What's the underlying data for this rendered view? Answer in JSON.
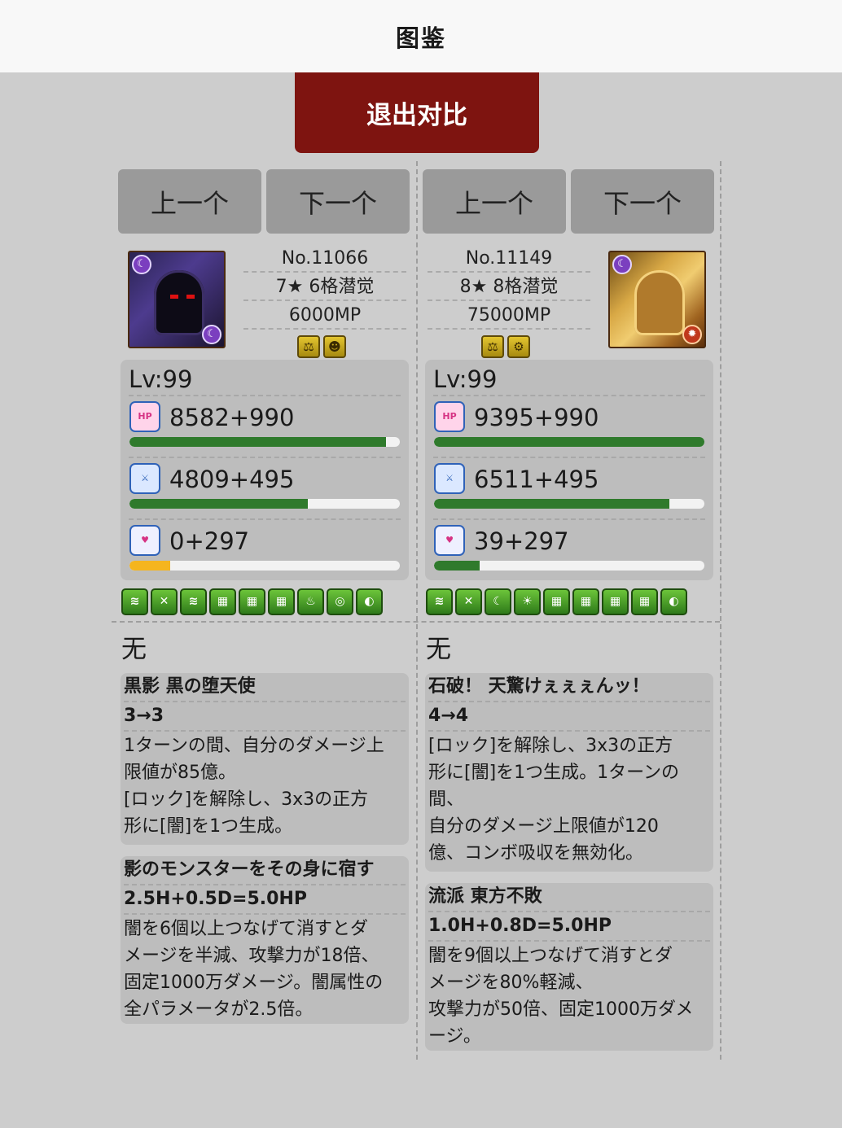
{
  "header": {
    "title": "图鉴"
  },
  "exit_button": "退出对比",
  "left": {
    "prev": "上一个",
    "next": "下一个",
    "number": "No.11066",
    "rarity": "7★ 6格潜觉",
    "mp": "6000MP",
    "types": [
      "balance-type-icon",
      "demon-type-icon"
    ],
    "level": "Lv:99",
    "hp": "8582+990",
    "atk": "4809+495",
    "rcv": "0+297",
    "hp_ratio": 0.95,
    "atk_ratio": 0.66,
    "rcv_ratio": 0.15,
    "awakenings": [
      "skill-boost",
      "jammer-resist",
      "skill-boost-plus",
      "combo-orb",
      "combo-orb",
      "combo-orb",
      "hp-up",
      "swirl",
      "blind-resist"
    ],
    "none_text": "无",
    "active_skill": {
      "name": "黒影 黒の堕天使",
      "cooldown": "3→3",
      "desc": "1ターンの間、自分のダメージ上\n限値が85億。\n[ロック]を解除し、3x3の正方\n形に[闇]を1つ生成。"
    },
    "leader_skill": {
      "name": "影のモンスターをその身に宿す",
      "multiplier": "2.5H+0.5D=5.0HP",
      "desc": "闇を6個以上つなげて消すとダ\nメージを半減、攻撃力が18倍、\n固定1000万ダメージ。闇属性の\n全パラメータが2.5倍。"
    }
  },
  "right": {
    "prev": "上一个",
    "next": "下一个",
    "number": "No.11149",
    "rarity": "8★ 8格潜觉",
    "mp": "75000MP",
    "types": [
      "balance-type-icon",
      "machine-type-icon"
    ],
    "level": "Lv:99",
    "hp": "9395+990",
    "atk": "6511+495",
    "rcv": "39+297",
    "hp_ratio": 1.0,
    "atk_ratio": 0.87,
    "rcv_ratio": 0.17,
    "awakenings": [
      "skill-boost",
      "jammer-resist",
      "dark-orb",
      "sun",
      "combo-orb",
      "combo-orb",
      "combo-orb",
      "combo-orb",
      "blind-resist"
    ],
    "none_text": "无",
    "active_skill": {
      "name": "石破！ 天驚けぇぇぇんッ！",
      "cooldown": "4→4",
      "desc": "[ロック]を解除し、3x3の正方\n形に[闇]を1つ生成。1ターンの\n間、\n自分のダメージ上限値が120\n億、コンボ吸収を無効化。"
    },
    "leader_skill": {
      "name": "流派 東方不敗",
      "multiplier": "1.0H+0.8D=5.0HP",
      "desc": "闇を9個以上つなげて消すとダ\nメージを80%軽減、\n攻撃力が50倍、固定1000万ダメ\nージ。"
    }
  }
}
